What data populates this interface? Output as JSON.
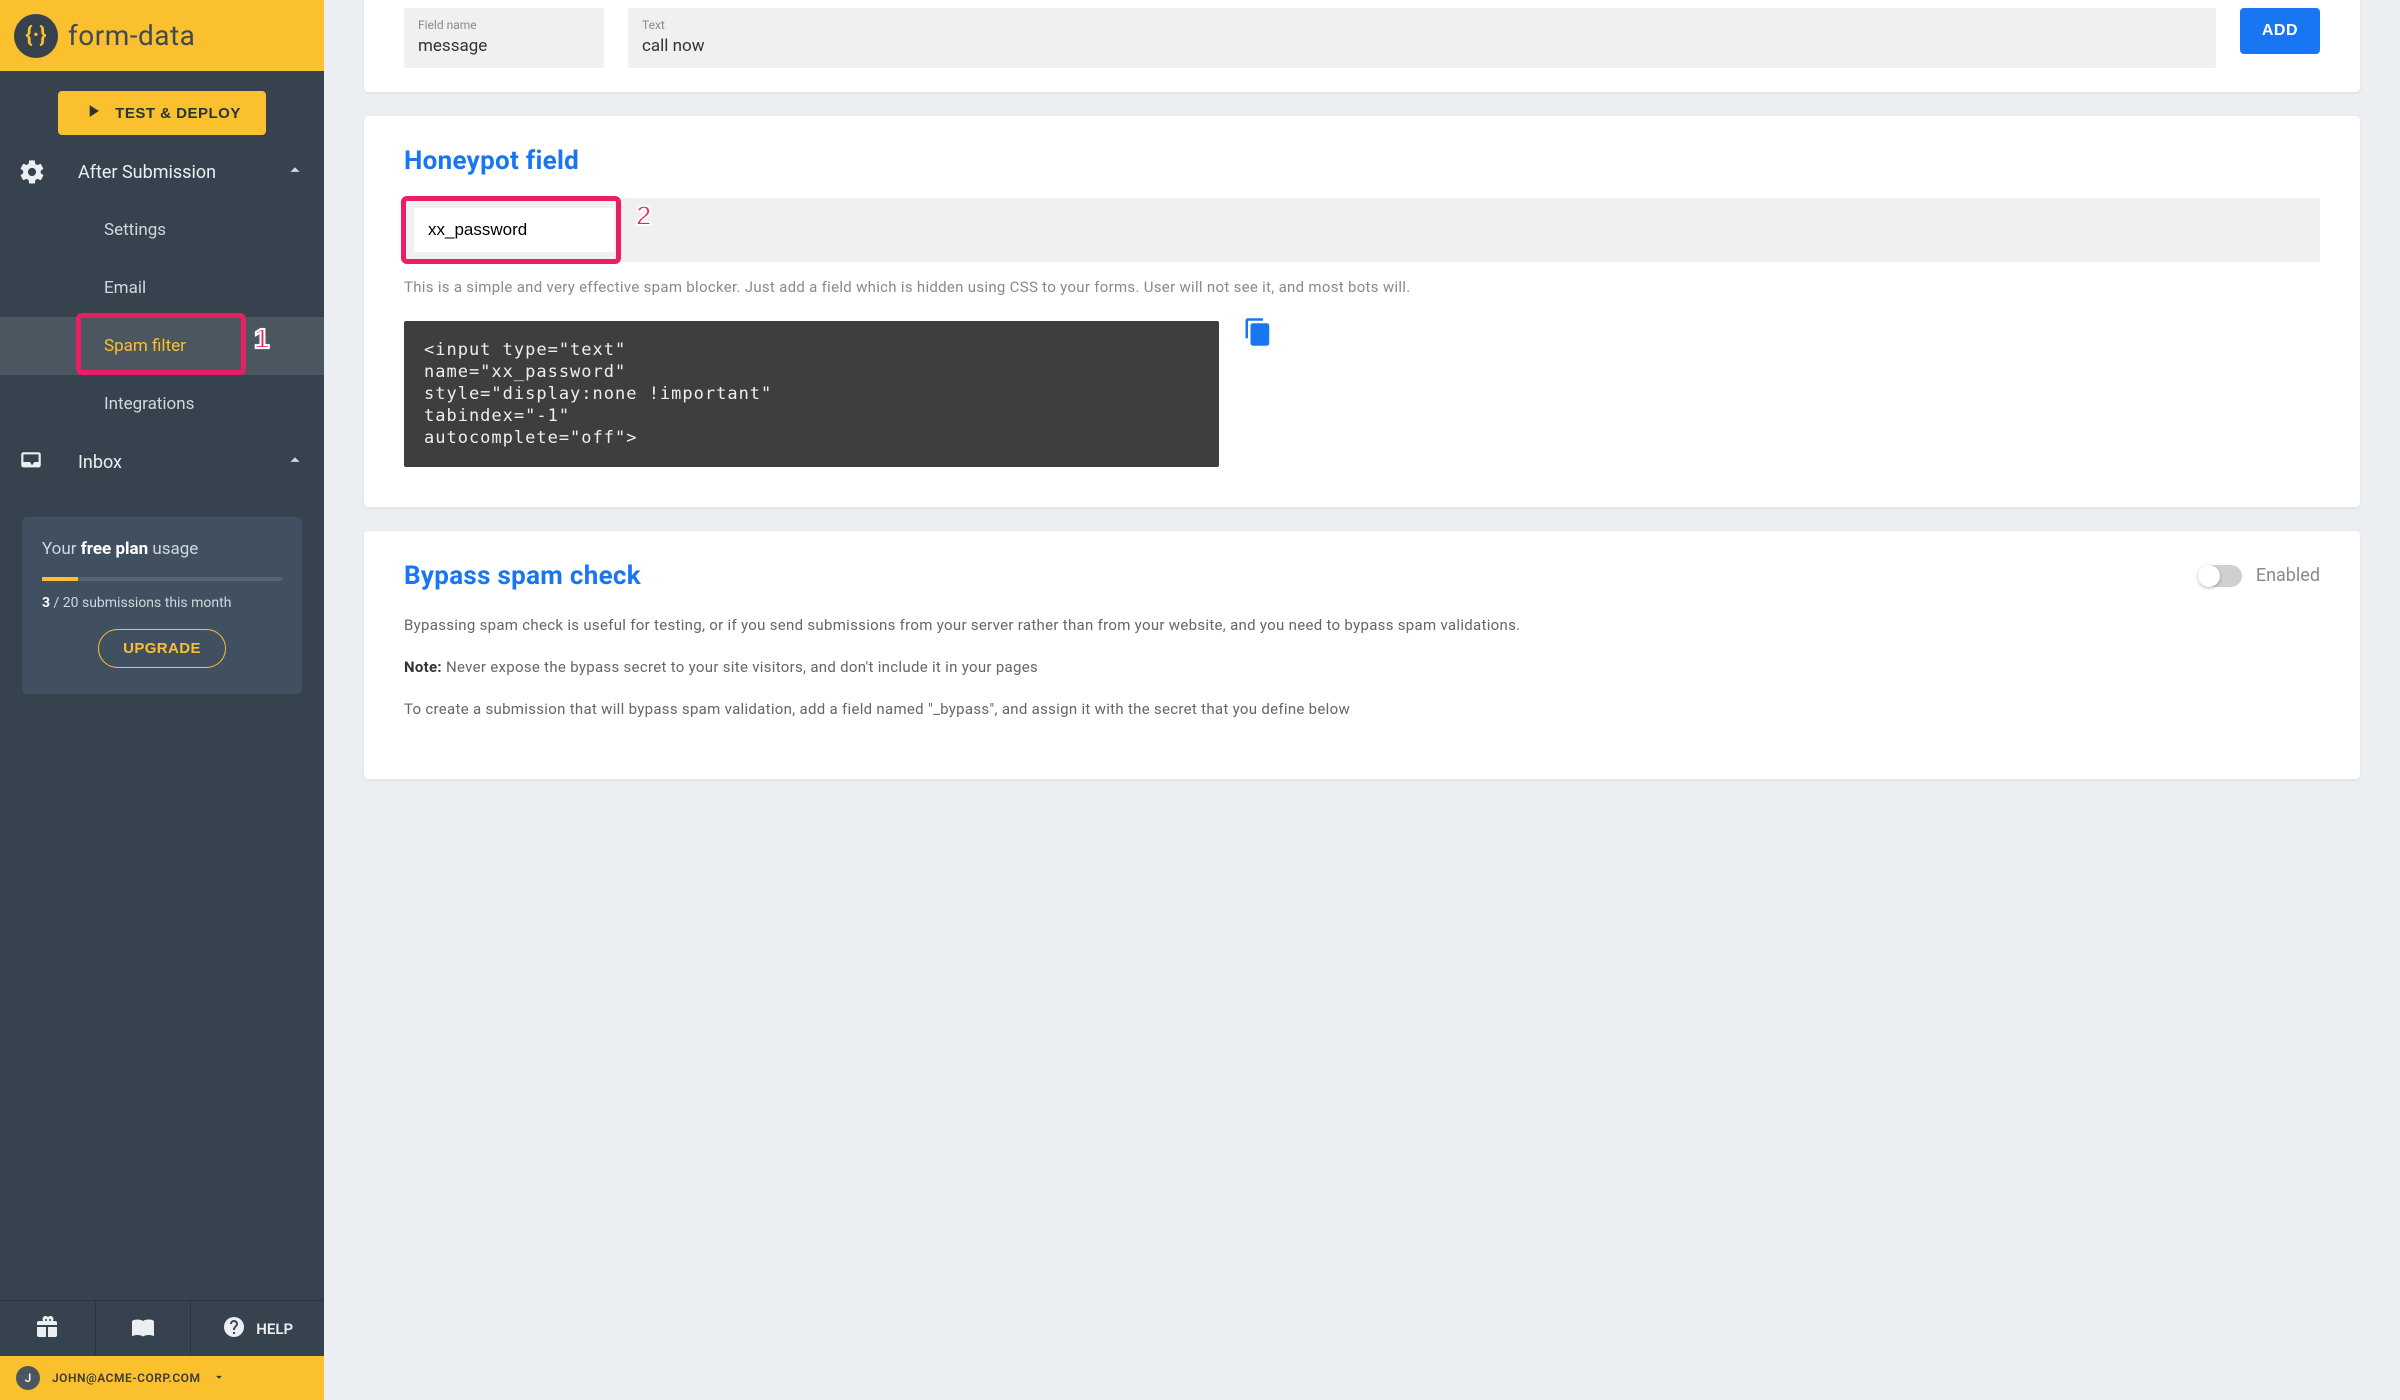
{
  "brand": {
    "name": "form-data",
    "glyph": "{·}"
  },
  "sidebar": {
    "test_deploy": "TEST & DEPLOY",
    "after_submission": "After Submission",
    "items": {
      "settings": "Settings",
      "email": "Email",
      "spam": "Spam filter",
      "integrations": "Integrations"
    },
    "inbox": "Inbox"
  },
  "usage": {
    "title_pre": "Your ",
    "title_bold": "free plan",
    "title_post": " usage",
    "count": "3",
    "count_rest": " / 20 submissions this month",
    "upgrade": "UPGRADE"
  },
  "bottom": {
    "help": "HELP"
  },
  "user": {
    "initial": "J",
    "email": "JOHN@ACME-CORP.COM"
  },
  "top_card": {
    "field_label": "Field name",
    "field_value": "message",
    "text_label": "Text",
    "text_value": "call now",
    "add": "ADD"
  },
  "honeypot": {
    "heading": "Honeypot field",
    "input_value": "xx_password",
    "help": "This is a simple and very effective spam blocker. Just add a field which is hidden using CSS to your forms. User will not see it, and most bots will.",
    "code": "<input type=\"text\" \nname=\"xx_password\" \nstyle=\"display:none !important\" \ntabindex=\"-1\" \nautocomplete=\"off\">"
  },
  "bypass": {
    "heading": "Bypass spam check",
    "enabled_label": "Enabled",
    "p1": "Bypassing spam check is useful for testing, or if you send submissions from your server rather than from your website, and you need to bypass spam validations.",
    "note_label": "Note:",
    "note_rest": " Never expose the bypass secret to your site visitors, and don't include it in your pages",
    "p3": "To create a submission that will bypass spam validation, add a field named \"_bypass\", and assign it with the secret that you define below"
  },
  "annotations": {
    "one": "1",
    "two": "2"
  }
}
